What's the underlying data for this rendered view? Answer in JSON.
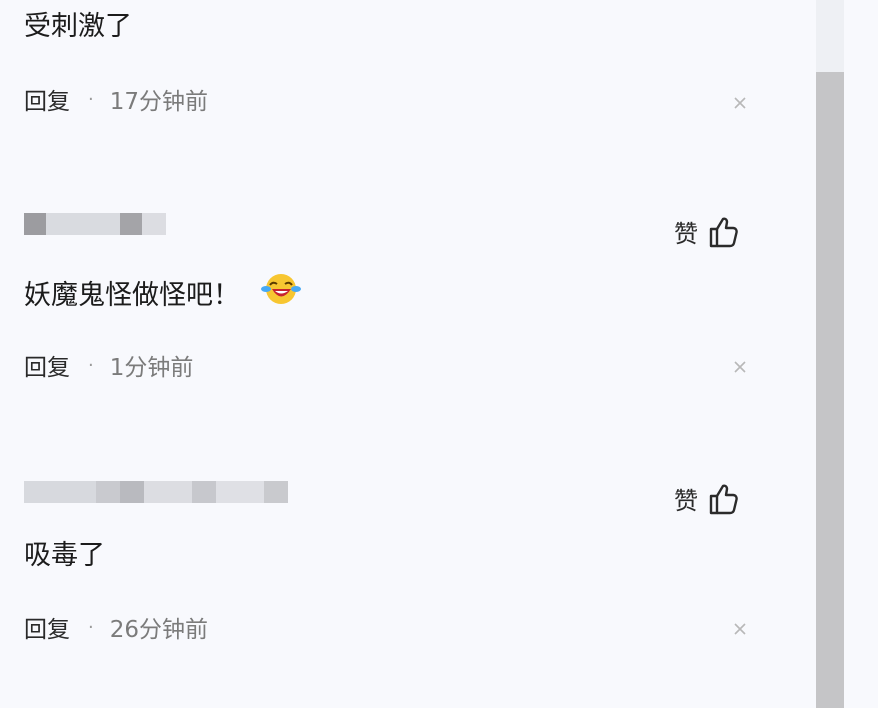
{
  "comments": [
    {
      "text": "受刺激了",
      "reply_label": "回复",
      "separator": "·",
      "time": "17分钟前"
    },
    {
      "text": "妖魔鬼怪做怪吧！",
      "emoji": "laughing-crying-face",
      "like_label": "赞",
      "reply_label": "回复",
      "separator": "·",
      "time": "1分钟前"
    },
    {
      "text": "吸毒了",
      "like_label": "赞",
      "reply_label": "回复",
      "separator": "·",
      "time": "26分钟前"
    }
  ],
  "icons": {
    "like": "thumbs-up-icon",
    "close": "close-icon"
  },
  "colors": {
    "background": "#f8f9fd",
    "scroll_thumb": "#c5c5c7"
  }
}
